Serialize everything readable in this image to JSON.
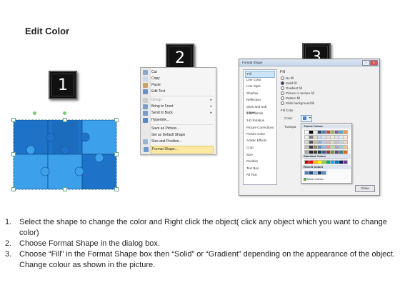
{
  "slide": {
    "title": "Edit Color"
  },
  "badges": [
    "1",
    "2",
    "3"
  ],
  "context_menu": {
    "items": [
      {
        "label": "Cut",
        "icon": "scissors-icon",
        "enabled": true,
        "submenu": false
      },
      {
        "label": "Copy",
        "icon": "copy-icon",
        "enabled": true,
        "submenu": false
      },
      {
        "label": "Paste",
        "icon": "paste-icon",
        "enabled": true,
        "submenu": false
      },
      {
        "label": "Edit Text",
        "icon": "edit-text-icon",
        "enabled": true,
        "submenu": false
      },
      {
        "label": "Group",
        "icon": "group-icon",
        "enabled": false,
        "submenu": true
      },
      {
        "label": "Bring to Front",
        "icon": "bring-front-icon",
        "enabled": true,
        "submenu": true
      },
      {
        "label": "Send to Back",
        "icon": "send-back-icon",
        "enabled": true,
        "submenu": true
      },
      {
        "label": "Hyperlink...",
        "icon": "hyperlink-icon",
        "enabled": true,
        "submenu": false
      },
      {
        "label": "Save as Picture...",
        "icon": "",
        "enabled": true,
        "submenu": false
      },
      {
        "label": "Set as Default Shape",
        "icon": "",
        "enabled": true,
        "submenu": false
      },
      {
        "label": "Size and Position...",
        "icon": "size-icon",
        "enabled": true,
        "submenu": false
      },
      {
        "label": "Format Shape...",
        "icon": "format-shape-icon",
        "enabled": true,
        "submenu": false,
        "selected": true
      }
    ]
  },
  "format_dialog": {
    "title": "Format Shape",
    "nav": [
      "Fill",
      "Line Color",
      "Line Style",
      "Shadow",
      "Reflection",
      "Glow and Soft Edges",
      "3-D Format",
      "3-D Rotation",
      "Picture Corrections",
      "Picture Color",
      "Artistic Effects",
      "Crop",
      "Size",
      "Position",
      "Text Box",
      "Alt Text"
    ],
    "pane_title": "Fill",
    "options": [
      {
        "label": "No fill",
        "selected": false
      },
      {
        "label": "Solid fill",
        "selected": true
      },
      {
        "label": "Gradient fill",
        "selected": false
      },
      {
        "label": "Picture or texture fill",
        "selected": false
      },
      {
        "label": "Pattern fill",
        "selected": false
      },
      {
        "label": "Slide background fill",
        "selected": false
      }
    ],
    "fill_color_label": "Fill Color",
    "color_label": "Color:",
    "transparency_label": "Transpa",
    "close_label": "Close"
  },
  "palette": {
    "theme_label": "Theme Colors",
    "standard_label": "Standard Colors",
    "recent_label": "Recent Colors",
    "more_label": "More Colors...",
    "theme_top": [
      "#ffffff",
      "#000000",
      "#eeece1",
      "#1f497d",
      "#4f81bd",
      "#c0504d",
      "#9bbb59",
      "#8064a2",
      "#4bacc6",
      "#f79646"
    ],
    "theme_shades": [
      [
        "#f2f2f2",
        "#7f7f7f",
        "#ddd9c3",
        "#c6d9f0",
        "#dbe5f1",
        "#f2dcdb",
        "#ebf1dd",
        "#e5e0ec",
        "#dbeef3",
        "#fdeada"
      ],
      [
        "#d8d8d8",
        "#595959",
        "#c4bd97",
        "#8db3e2",
        "#b8cce4",
        "#e5b9b7",
        "#d7e3bc",
        "#ccc1d9",
        "#b7dde8",
        "#fbd5b5"
      ],
      [
        "#bfbfbf",
        "#3f3f3f",
        "#938953",
        "#548dd4",
        "#95b3d7",
        "#d99694",
        "#c3d69b",
        "#b2a2c7",
        "#92cddc",
        "#fac08f"
      ],
      [
        "#a5a5a5",
        "#262626",
        "#494429",
        "#17365d",
        "#366092",
        "#953734",
        "#76923c",
        "#5f497a",
        "#31859b",
        "#e36c09"
      ],
      [
        "#7f7f7f",
        "#0c0c0c",
        "#1d1b10",
        "#0f243e",
        "#244061",
        "#632423",
        "#4f6128",
        "#3f3151",
        "#205867",
        "#974806"
      ]
    ],
    "standard": [
      "#c00000",
      "#ff0000",
      "#ffc000",
      "#ffff00",
      "#92d050",
      "#00b050",
      "#00b0f0",
      "#0070c0",
      "#002060",
      "#7030a0"
    ],
    "recent": [
      "#4f81bd",
      "#1f497d",
      "#8db3e2",
      "#17365d",
      "#548dd4"
    ]
  },
  "puzzle": {
    "colors": {
      "dark": "#1e73c8",
      "light": "#3ca0ea",
      "stroke": "#0d4f8f"
    }
  },
  "instructions": [
    {
      "num": "1.",
      "text": "Select the shape to change the color and Right click the object( click any object which you want to change color)"
    },
    {
      "num": "2.",
      "text": "Choose Format Shape in the dialog box."
    },
    {
      "num": "3.",
      "text": "Choose “Fill” in the Format Shape box then “Solid” or “Gradient” depending on the appearance of the object. Change colour as shown in the picture."
    }
  ]
}
